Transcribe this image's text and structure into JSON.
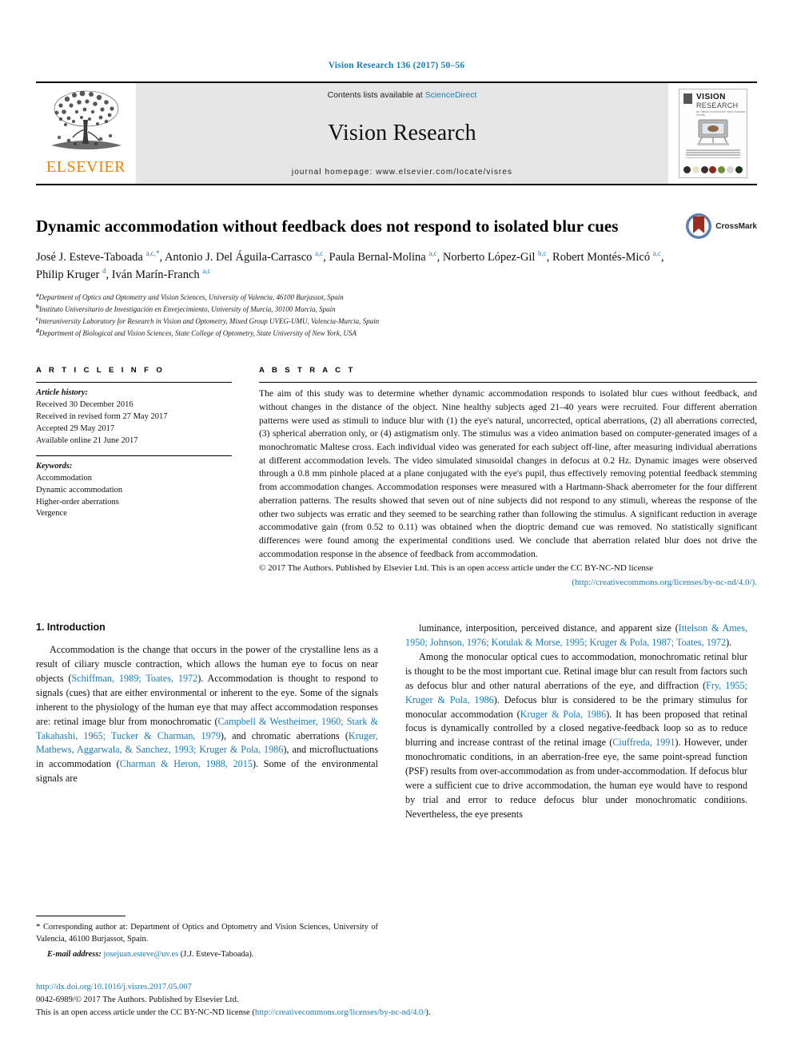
{
  "running_head": "Vision Research 136 (2017) 50–56",
  "masthead": {
    "contents_prefix": "Contents lists available at ",
    "sciencedirect": "ScienceDirect",
    "journal_title": "Vision Research",
    "homepage": "journal homepage: www.elsevier.com/locate/visres",
    "publisher_logo_text": "ELSEVIER",
    "publisher_logo_color": "#f08000",
    "link_color": "#1a7db5",
    "cover": {
      "line1": "VISION",
      "line2": "RESEARCH",
      "line3": "An Official Journal of the Vision Sciences Society"
    }
  },
  "article": {
    "title": "Dynamic accommodation without feedback does not respond to isolated blur cues",
    "crossmark_label": "CrossMark",
    "authors_html": "José J. Esteve-Taboada <sup>a,c,</sup><sup class=\"star\">*</sup>, Antonio J. Del Águila-Carrasco <sup>a,c</sup>, Paula Bernal-Molina <sup>a,c</sup>, Norberto López-Gil <sup>b,c</sup>, Robert Montés-Micó <sup>a,c</sup>, Philip Kruger <sup>d</sup>, Iván Marín-Franch <sup>a,c</sup>",
    "affiliations": [
      {
        "marker": "a",
        "text": "Department of Optics and Optometry and Vision Sciences, University of Valencia, 46100 Burjassot, Spain"
      },
      {
        "marker": "b",
        "text": "Instituto Universitario de Investigación en Envejecimiento, University of Murcia, 30100 Murcia, Spain"
      },
      {
        "marker": "c",
        "text": "Interuniversity Laboratory for Research in Vision and Optometry, Mixed Group UVEG-UMU, Valencia-Murcia, Spain"
      },
      {
        "marker": "d",
        "text": "Department of Biological and Vision Sciences, State College of Optometry, State University of New York, USA"
      }
    ]
  },
  "article_info": {
    "heading": "A R T I C L E   I N F O",
    "history_label": "Article history:",
    "history": [
      "Received 30 December 2016",
      "Received in revised form 27 May 2017",
      "Accepted 29 May 2017",
      "Available online 21 June 2017"
    ],
    "keywords_label": "Keywords:",
    "keywords": [
      "Accommodation",
      "Dynamic accommodation",
      "Higher-order aberrations",
      "Vergence"
    ]
  },
  "abstract": {
    "heading": "A B S T R A C T",
    "text": "The aim of this study was to determine whether dynamic accommodation responds to isolated blur cues without feedback, and without changes in the distance of the object. Nine healthy subjects aged 21–40 years were recruited. Four different aberration patterns were used as stimuli to induce blur with (1) the eye's natural, uncorrected, optical aberrations, (2) all aberrations corrected, (3) spherical aberration only, or (4) astigmatism only. The stimulus was a video animation based on computer-generated images of a monochromatic Maltese cross. Each individual video was generated for each subject off-line, after measuring individual aberrations at different accommodation levels. The video simulated sinusoidal changes in defocus at 0.2 Hz. Dynamic images were observed through a 0.8 mm pinhole placed at a plane conjugated with the eye's pupil, thus effectively removing potential feedback stemming from accommodation changes. Accommodation responses were measured with a Hartmann-Shack aberrometer for the four different aberration patterns. The results showed that seven out of nine subjects did not respond to any stimuli, whereas the response of the other two subjects was erratic and they seemed to be searching rather than following the stimulus. A significant reduction in average accommodative gain (from 0.52 to 0.11) was obtained when the dioptric demand cue was removed. No statistically significant differences were found among the experimental conditions used. We conclude that aberration related blur does not drive the accommodation response in the absence of feedback from accommodation.",
    "copyright": "© 2017 The Authors. Published by Elsevier Ltd. This is an open access article under the CC BY-NC-ND license",
    "license_url": "(http://creativecommons.org/licenses/by-nc-nd/4.0/)."
  },
  "introduction": {
    "heading": "1. Introduction",
    "left_column_html": "Accommodation is the change that occurs in the power of the crystalline lens as a result of ciliary muscle contraction, which allows the human eye to focus on near objects (<span class=\"lnk\">Schiffman, 1989; Toates, 1972</span>). Accommodation is thought to respond to signals (cues) that are either environmental or inherent to the eye. Some of the signals inherent to the physiology of the human eye that may affect accommodation responses are: retinal image blur from monochromatic (<span class=\"lnk\">Campbell &amp; Westheimer, 1960; Stark &amp; Takahashi, 1965; Tucker &amp; Charman, 1979</span>), and chromatic aberrations (<span class=\"lnk\">Kruger, Mathews, Aggarwala, &amp; Sanchez, 1993; Kruger &amp; Pola, 1986</span>), and microfluctuations in accommodation (<span class=\"lnk\">Charman &amp; Heron, 1988, 2015</span>). Some of the environmental signals are",
    "right_column_p1_html": "luminance, interposition, perceived distance, and apparent size (<span class=\"lnk\">Ittelson &amp; Ames, 1950; Johnson, 1976; Kotulak &amp; Morse, 1995; Kruger &amp; Pola, 1987; Toates, 1972</span>).",
    "right_column_p2_html": "Among the monocular optical cues to accommodation, monochromatic retinal blur is thought to be the most important cue. Retinal image blur can result from factors such as defocus blur and other natural aberrations of the eye, and diffraction (<span class=\"lnk\">Fry, 1955; Kruger &amp; Pola, 1986</span>). Defocus blur is considered to be the primary stimulus for monocular accommodation (<span class=\"lnk\">Kruger &amp; Pola, 1986</span>). It has been proposed that retinal focus is dynamically controlled by a closed negative-feedback loop so as to reduce blurring and increase contrast of the retinal image (<span class=\"lnk\">Ciuffreda, 1991</span>). However, under monochromatic conditions, in an aberration-free eye, the same point-spread function (PSF) results from over-accommodation as from under-accommodation. If defocus blur were a sufficient cue to drive accommodation, the human eye would have to respond by trial and error to reduce defocus blur under monochromatic conditions. Nevertheless, the eye presents"
  },
  "footnotes": {
    "corresponding_html": "<span class=\"star\">*</span> Corresponding author at: Department of Optics and Optometry and Vision Sciences, University of Valencia, 46100 Burjassot, Spain.",
    "email_label": "E-mail address:",
    "email": "josejuan.esteve@uv.es",
    "email_owner": "(J.J. Esteve-Taboada)."
  },
  "bottom": {
    "doi": "http://dx.doi.org/10.1016/j.visres.2017.05.007",
    "issn_line": "0042-6989/© 2017 The Authors. Published by Elsevier Ltd.",
    "license_prefix": "This is an open access article under the CC BY-NC-ND license (",
    "license_url": "http://creativecommons.org/licenses/by-nc-nd/4.0/",
    "license_suffix": ")."
  }
}
